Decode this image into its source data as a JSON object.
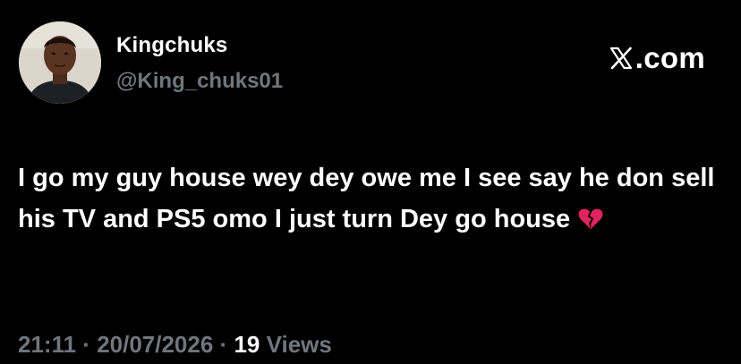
{
  "author": {
    "display_name": "Kingchuks",
    "handle": "@King_chuks01"
  },
  "site": {
    "label": ".com",
    "logo_icon": "x-logo-icon"
  },
  "tweet": {
    "text": "I go my guy house wey dey owe me I see say he don sell his TV and PS5 omo I just turn Dey go house",
    "emoji_icon": "broken-heart-icon"
  },
  "meta": {
    "time": "21:11",
    "separator": " · ",
    "date": "20/07/2026",
    "views_count": "19",
    "views_label": "Views"
  },
  "colors": {
    "background": "#000000",
    "text": "#ffffff",
    "muted": "#6f767d",
    "heart": "#e0245e"
  }
}
